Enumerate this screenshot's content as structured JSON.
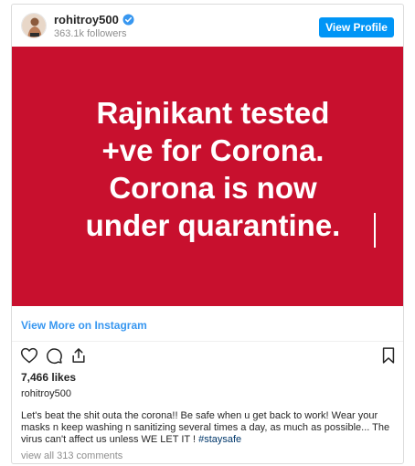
{
  "header": {
    "username": "rohitroy500",
    "followers": "363.1k followers",
    "view_profile_label": "View Profile"
  },
  "post": {
    "image_text_lines": [
      "Rajnikant tested",
      "+ve for Corona.",
      "Corona is now",
      "under quarantine."
    ],
    "image_bg_color": "#c8102e"
  },
  "view_more_label": "View More on Instagram",
  "actions": {
    "icons": [
      "heart-icon",
      "comment-icon",
      "share-icon",
      "bookmark-icon"
    ]
  },
  "likes": "7,466 likes",
  "owner_username": "rohitroy500",
  "caption": {
    "text": "Let's beat the shit outa the corona!! Be safe when u get back to work! Wear your masks n keep washing n sanitizing several times a day, as much as possible... The virus can't affect us unless WE LET IT ! ",
    "hashtag": "#staysafe"
  },
  "comments_link": "view all 313 comments",
  "colors": {
    "accent": "#0095f6",
    "link": "#3897f0",
    "post_bg": "#c8102e"
  }
}
